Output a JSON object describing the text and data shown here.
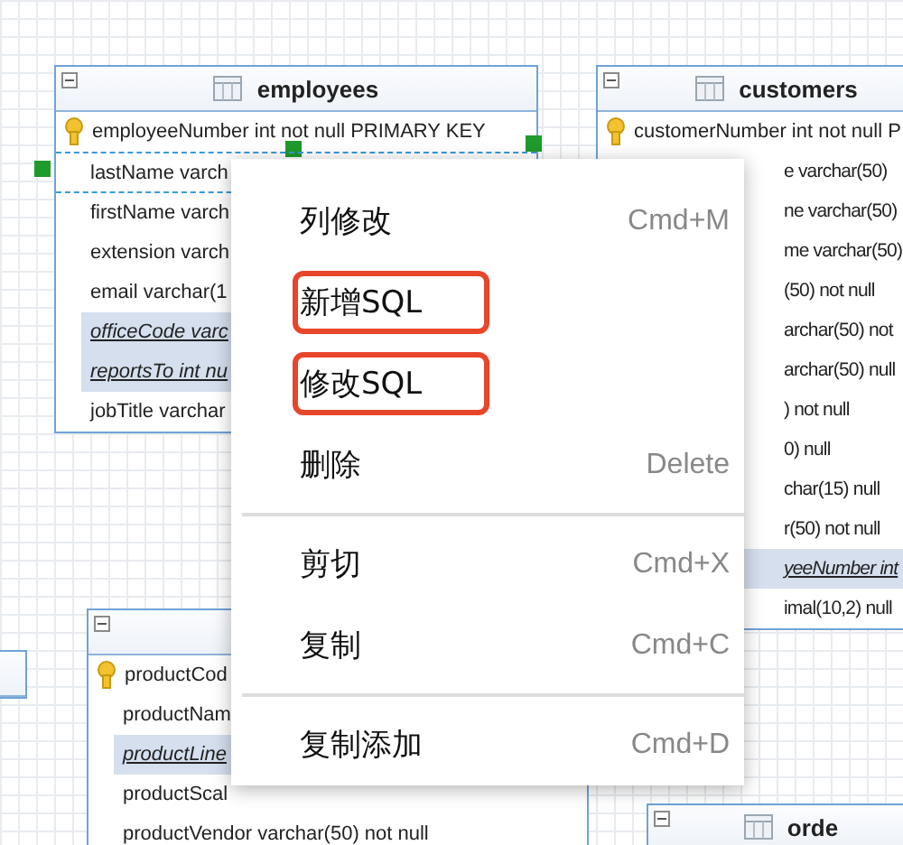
{
  "tables": [
    {
      "kind": "table",
      "title": "employees",
      "rows": [
        {
          "text": "employeeNumber int not null PRIMARY KEY",
          "kind": "key",
          "selected": false,
          "starts_hidden": false
        },
        {
          "text": "lastName varch",
          "kind": "plain",
          "selected": true,
          "starts_hidden": false
        },
        {
          "text": "firstName varch",
          "kind": "plain",
          "selected": false,
          "starts_hidden": false
        },
        {
          "text": "extension varch",
          "kind": "plain",
          "selected": false,
          "starts_hidden": false
        },
        {
          "text": "email varchar(1",
          "kind": "plain",
          "selected": false,
          "starts_hidden": false
        },
        {
          "text": "officeCode varc",
          "kind": "foreign",
          "selected": false,
          "starts_hidden": false
        },
        {
          "text": "reportsTo int nu",
          "kind": "foreign",
          "selected": false,
          "starts_hidden": false
        },
        {
          "text": "jobTitle varchar",
          "kind": "plain",
          "selected": false,
          "starts_hidden": false
        }
      ]
    },
    {
      "kind": "table",
      "title": "customers",
      "rows": [
        {
          "text": "customerNumber int not null P",
          "kind": "key",
          "selected": false,
          "starts_hidden": false
        },
        {
          "text": "e varchar(50)",
          "kind": "plain",
          "selected": false,
          "starts_hidden": true
        },
        {
          "text": "ne varchar(50)",
          "kind": "plain",
          "selected": false,
          "starts_hidden": true
        },
        {
          "text": "me varchar(50)",
          "kind": "plain",
          "selected": false,
          "starts_hidden": true
        },
        {
          "text": "(50) not null",
          "kind": "plain",
          "selected": false,
          "starts_hidden": true
        },
        {
          "text": "archar(50) not",
          "kind": "plain",
          "selected": false,
          "starts_hidden": true
        },
        {
          "text": "archar(50) null",
          "kind": "plain",
          "selected": false,
          "starts_hidden": true
        },
        {
          "text": ") not null",
          "kind": "plain",
          "selected": false,
          "starts_hidden": true
        },
        {
          "text": "0) null",
          "kind": "plain",
          "selected": false,
          "starts_hidden": true
        },
        {
          "text": "char(15) null",
          "kind": "plain",
          "selected": false,
          "starts_hidden": true
        },
        {
          "text": "r(50) not null",
          "kind": "plain",
          "selected": false,
          "starts_hidden": true
        },
        {
          "text": "yeeNumber int",
          "kind": "foreign",
          "selected": false,
          "starts_hidden": true
        },
        {
          "text": "imal(10,2) null",
          "kind": "plain",
          "selected": false,
          "starts_hidden": true
        }
      ]
    },
    {
      "kind": "table"
    },
    {
      "kind": "table",
      "rows": [
        {
          "text": "productCod",
          "kind": "key",
          "selected": false,
          "starts_hidden": false
        },
        {
          "text": "productNam",
          "kind": "plain",
          "selected": false,
          "starts_hidden": false
        },
        {
          "text": "productLine",
          "kind": "foreign",
          "selected": false,
          "starts_hidden": false
        },
        {
          "text": "productScal",
          "kind": "plain",
          "selected": false,
          "starts_hidden": false
        },
        {
          "text": "productVendor varchar(50) not null",
          "kind": "plain",
          "selected": false,
          "starts_hidden": false
        }
      ]
    },
    {
      "kind": "table",
      "title": "orde"
    }
  ],
  "context_menu": {
    "groups": [
      [
        {
          "label": "列修改",
          "shortcut": "Cmd+M",
          "highlighted": false
        },
        {
          "label": "新增SQL",
          "highlighted": true
        },
        {
          "label": "修改SQL",
          "highlighted": true
        },
        {
          "label": "删除",
          "shortcut": "Delete",
          "highlighted": false
        }
      ],
      [
        {
          "label": "剪切",
          "shortcut": "Cmd+X",
          "highlighted": false
        },
        {
          "label": "复制",
          "shortcut": "Cmd+C",
          "highlighted": false
        }
      ],
      [
        {
          "label": "复制添加",
          "shortcut": "Cmd+D",
          "highlighted": false
        }
      ]
    ]
  }
}
